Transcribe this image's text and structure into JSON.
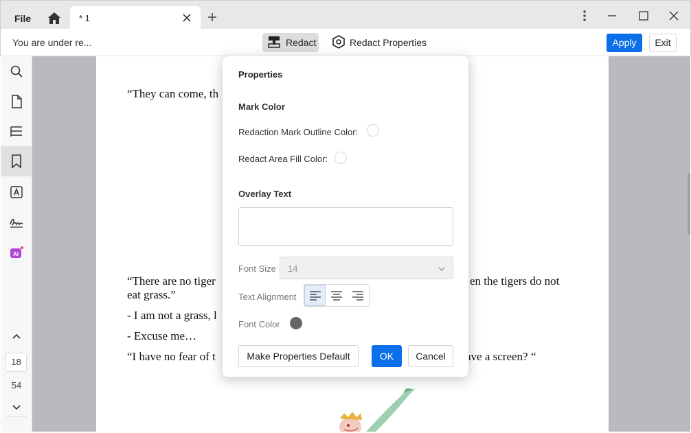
{
  "titlebar": {
    "file_label": "File",
    "tab_title": "* 1"
  },
  "toolbar": {
    "status_text": "You are under re...",
    "redact_label": "Redact",
    "redact_properties_label": "Redact Properties",
    "apply_label": "Apply",
    "exit_label": "Exit"
  },
  "sidebar": {
    "current_page": "18",
    "total_pages": "54"
  },
  "document": {
    "lines": [
      "“They can come, th",
      "“There are no tiger",
      "en the tigers do not",
      "eat grass.”",
      "- I am not a grass, l",
      "- Excuse me…",
      "“I have no fear of t",
      "ave a screen? “"
    ]
  },
  "dialog": {
    "title": "Properties",
    "mark_color_section": "Mark Color",
    "outline_color_label": "Redaction Mark Outline Color:",
    "fill_color_label": "Redact Area Fill Color:",
    "overlay_text_section": "Overlay Text",
    "overlay_text_value": "",
    "font_size_label": "Font Size",
    "font_size_value": "14",
    "text_alignment_label": "Text Alignment",
    "text_alignment_selected": "left",
    "font_color_label": "Font Color",
    "font_color": "#666666",
    "make_default_label": "Make Properties Default",
    "ok_label": "OK",
    "cancel_label": "Cancel"
  },
  "colors": {
    "accent": "#0a6fe8"
  }
}
